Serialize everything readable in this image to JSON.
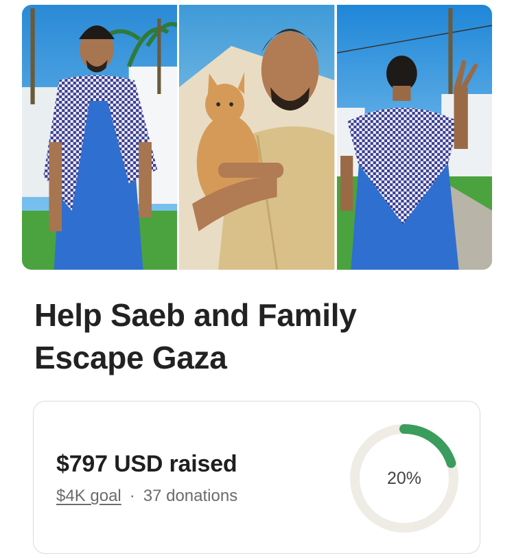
{
  "campaign": {
    "title": "Help Saeb and Family Escape Gaza",
    "raised_text": "$797 USD raised",
    "goal_text": "$4K goal",
    "separator": "·",
    "donations_text": "37 donations",
    "progress_label": "20%",
    "progress_fraction": 0.2
  },
  "colors": {
    "accent": "#3a9d5d",
    "ring_track": "#efece6",
    "card_border": "#dedbd6",
    "text_primary": "#222222",
    "text_secondary": "#6b6b6b"
  },
  "photos": [
    {
      "icon": "photo-man-keffiyeh-front"
    },
    {
      "icon": "photo-man-holding-cat"
    },
    {
      "icon": "photo-man-keffiyeh-back"
    }
  ]
}
